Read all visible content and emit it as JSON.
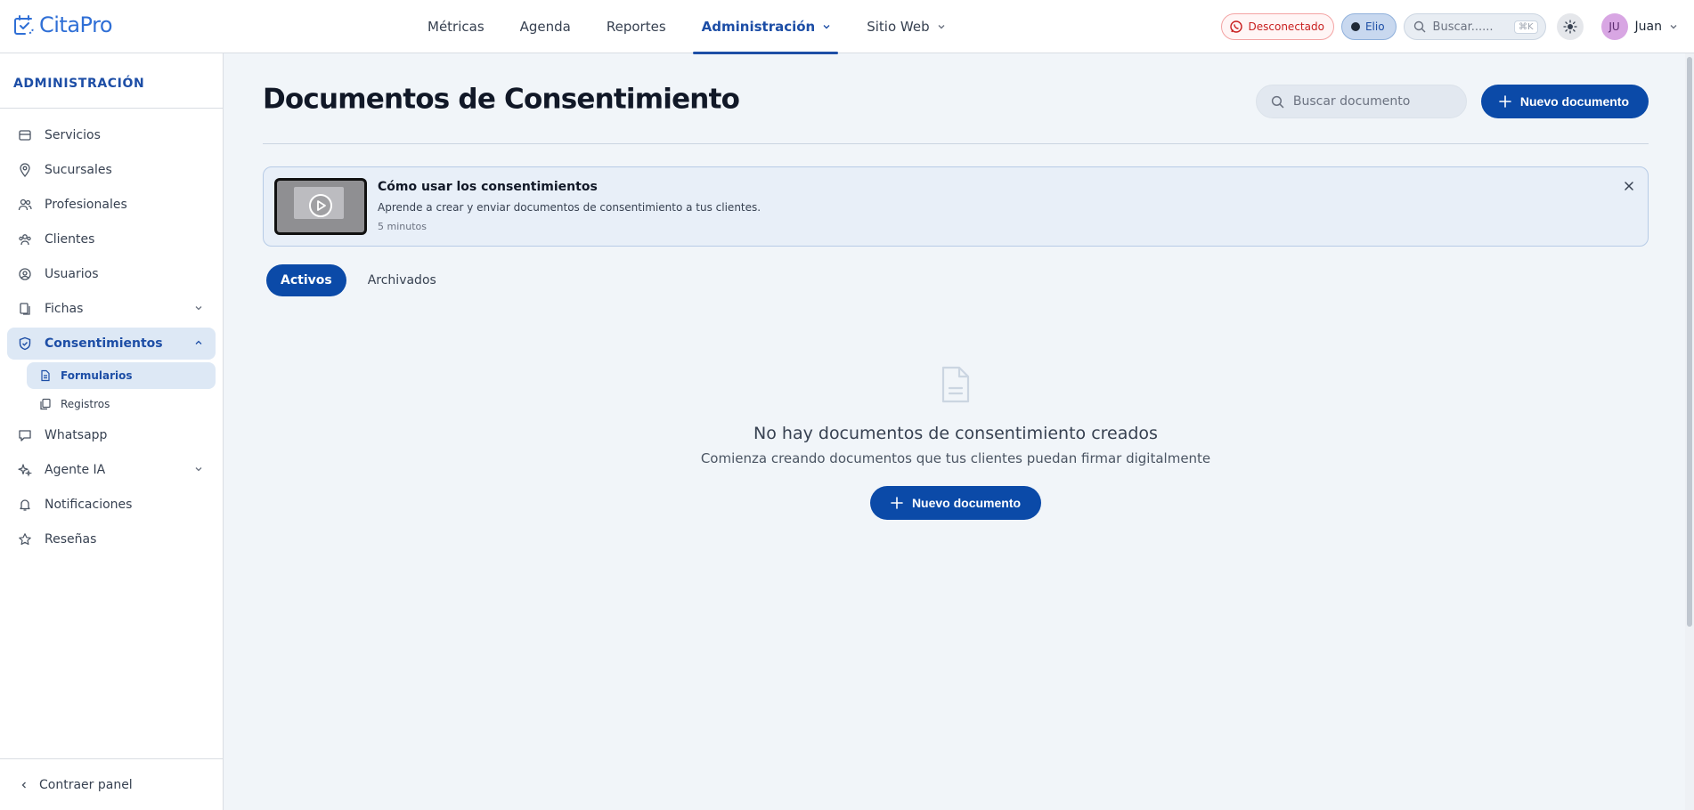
{
  "app": {
    "logo_text": "CitaPro",
    "brand_color": "#2f6fd6",
    "accent_color": "#0b4aa8"
  },
  "nav": {
    "items": [
      {
        "label": "Métricas"
      },
      {
        "label": "Agenda"
      },
      {
        "label": "Reportes"
      },
      {
        "label": "Administración",
        "active": true,
        "has_dropdown": true
      },
      {
        "label": "Sitio Web",
        "has_dropdown": true
      }
    ]
  },
  "topright": {
    "whatsapp_status": "Desconectado",
    "assistant": "Elio",
    "search_placeholder": "Buscar......",
    "search_shortcut": "⌘K",
    "theme_icon": "sun-icon",
    "user_initials": "JU",
    "user_name": "Juan"
  },
  "sidebar": {
    "title": "ADMINISTRACIÓN",
    "items": [
      {
        "label": "Servicios",
        "icon": "box-icon"
      },
      {
        "label": "Sucursales",
        "icon": "map-pin-icon"
      },
      {
        "label": "Profesionales",
        "icon": "users-icon"
      },
      {
        "label": "Clientes",
        "icon": "group-icon"
      },
      {
        "label": "Usuarios",
        "icon": "user-circle-icon"
      },
      {
        "label": "Fichas",
        "icon": "files-icon",
        "expandable": true
      },
      {
        "label": "Consentimientos",
        "icon": "shield-check-icon",
        "expandable": true,
        "expanded": true,
        "active": true
      }
    ],
    "subitems": [
      {
        "label": "Formularios",
        "icon": "file-text-icon",
        "active": true
      },
      {
        "label": "Registros",
        "icon": "copy-icon"
      }
    ],
    "items_after": [
      {
        "label": "Whatsapp",
        "icon": "chat-icon"
      },
      {
        "label": "Agente IA",
        "icon": "sparkles-icon",
        "expandable": true
      },
      {
        "label": "Notificaciones",
        "icon": "bell-icon"
      },
      {
        "label": "Reseñas",
        "icon": "star-icon"
      }
    ],
    "collapse_label": "Contraer panel"
  },
  "page": {
    "title": "Documentos de Consentimiento",
    "search_placeholder": "Buscar documento",
    "new_button": "Nuevo documento"
  },
  "banner": {
    "title": "Cómo usar los consentimientos",
    "description": "Aprende a crear y enviar documentos de consentimiento a tus clientes.",
    "duration": "5 minutos"
  },
  "tabs": [
    {
      "label": "Activos",
      "active": true
    },
    {
      "label": "Archivados"
    }
  ],
  "empty_state": {
    "title": "No hay documentos de consentimiento creados",
    "subtitle": "Comienza creando documentos que tus clientes puedan firmar digitalmente",
    "button": "Nuevo documento"
  }
}
